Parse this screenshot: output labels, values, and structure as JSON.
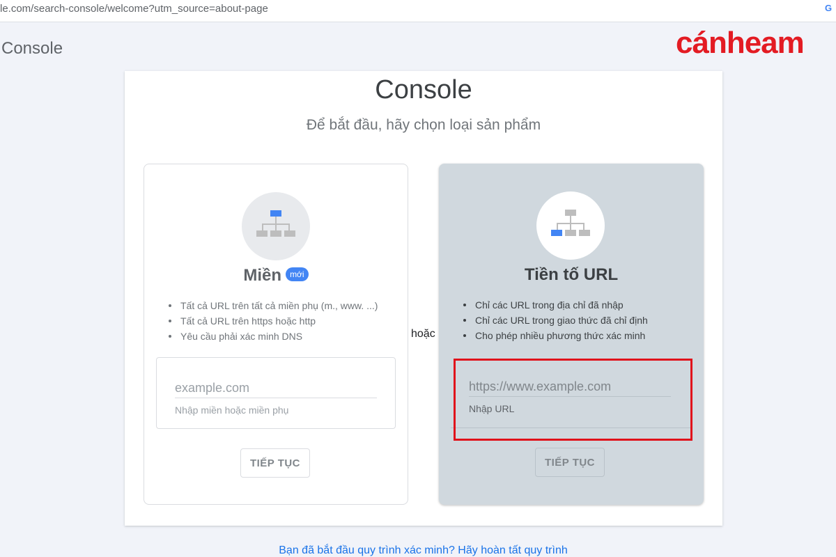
{
  "browser": {
    "url": "le.com/search-console/welcome?utm_source=about-page",
    "g_icon": "G"
  },
  "app": {
    "title": "Console"
  },
  "logo": {
    "text": "cánheam",
    "color": "#e31b23"
  },
  "card": {
    "title": "Console",
    "subtitle": "Để bắt đầu, hãy chọn loại sản phẩm",
    "or_label": "hoặc"
  },
  "domain_panel": {
    "heading": "Miền",
    "badge": "mới",
    "icon": "sitemap-top-highlighted-icon",
    "bullets": [
      "Tất cả URL trên tất cả miền phụ (m., www. ...)",
      "Tất cả URL trên https hoặc http",
      "Yêu cầu phải xác minh DNS"
    ],
    "input": {
      "value": "",
      "placeholder": "example.com",
      "hint": "Nhập miền hoặc miền phụ"
    },
    "button": "TIẾP TỤC"
  },
  "url_prefix_panel": {
    "heading": "Tiền tố URL",
    "icon": "sitemap-left-highlighted-icon",
    "bullets": [
      "Chỉ các URL trong địa chỉ đã nhập",
      "Chỉ các URL trong giao thức đã chỉ định",
      "Cho phép nhiều phương thức xác minh"
    ],
    "input": {
      "value": "",
      "placeholder": "https://www.example.com",
      "hint": "Nhập URL"
    },
    "button": "TIẾP TỤC"
  },
  "footer": {
    "link": "Bạn đã bắt đầu quy trình xác minh? Hãy hoàn tất quy trình"
  },
  "colors": {
    "accent_blue": "#4285f4",
    "link_blue": "#1a73e8",
    "selected_panel_bg": "#d0d8de",
    "highlight_red": "#e0121b"
  }
}
